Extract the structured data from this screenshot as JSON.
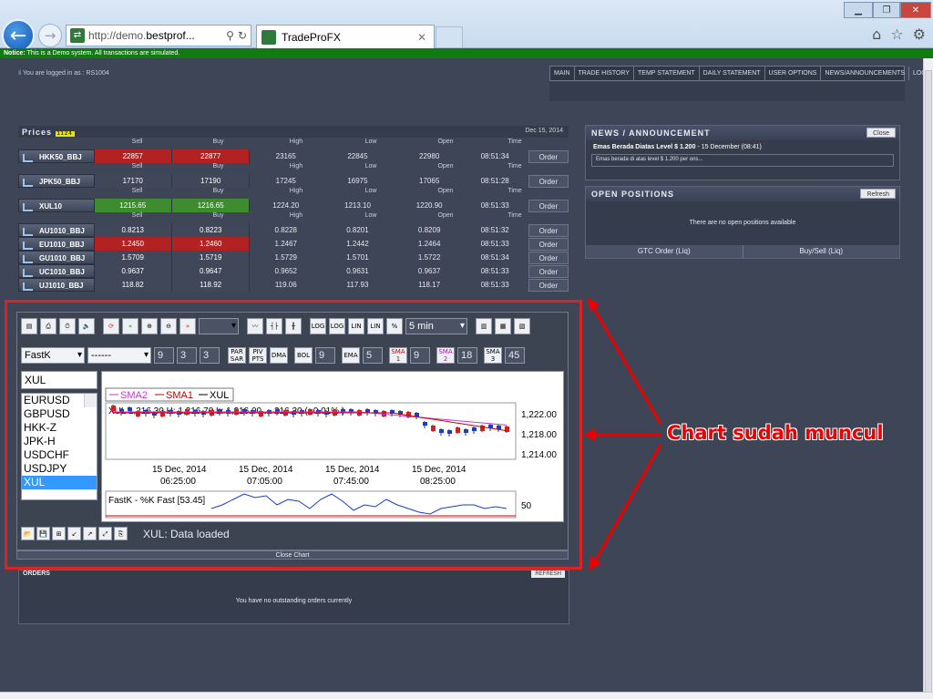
{
  "browser": {
    "url_prefix": "http://demo.",
    "url_domain": "bestprof...",
    "tab_title": "TradeProFX"
  },
  "notice": {
    "label": "Notice:",
    "text": "This is a Demo system. All transactions are simulated."
  },
  "header": {
    "logged_in": "You are logged in as : RS1004",
    "menu": [
      "Main",
      "Trade History",
      "Temp Statement",
      "Daily Statement",
      "User Options",
      "News/Announcements",
      "Logout"
    ]
  },
  "prices": {
    "title": "Prices",
    "date": "Dec 15, 2014",
    "columns": [
      "Sell",
      "Buy",
      "High",
      "Low",
      "Open",
      "Time"
    ],
    "order_label": "Order",
    "rows": [
      {
        "symbol": "HKK50_BBJ",
        "sell": "22857",
        "buy": "22877",
        "high": "23165",
        "low": "22845",
        "open": "22980",
        "time": "08:51:34",
        "color": "red",
        "header": true
      },
      {
        "symbol": "JPK50_BBJ",
        "sell": "17170",
        "buy": "17190",
        "high": "17245",
        "low": "16975",
        "open": "17065",
        "time": "08:51:28",
        "color": "neutral",
        "header": true
      },
      {
        "symbol": "XUL10",
        "sell": "1215.65",
        "buy": "1216.65",
        "high": "1224.20",
        "low": "1213.10",
        "open": "1220.90",
        "time": "08:51:33",
        "color": "green",
        "header": true
      },
      {
        "symbol": "AU1010_BBJ",
        "sell": "0.8213",
        "buy": "0.8223",
        "high": "0.8228",
        "low": "0.8201",
        "open": "0.8209",
        "time": "08:51:32",
        "color": "neutral",
        "header": true
      },
      {
        "symbol": "EU1010_BBJ",
        "sell": "1.2450",
        "buy": "1.2460",
        "high": "1.2467",
        "low": "1.2442",
        "open": "1.2464",
        "time": "08:51:33",
        "color": "red",
        "header": false
      },
      {
        "symbol": "GU1010_BBJ",
        "sell": "1.5709",
        "buy": "1.5719",
        "high": "1.5729",
        "low": "1.5701",
        "open": "1.5722",
        "time": "08:51:34",
        "color": "neutral",
        "header": false
      },
      {
        "symbol": "UC1010_BBJ",
        "sell": "0.9637",
        "buy": "0.9647",
        "high": "0.9652",
        "low": "0.9631",
        "open": "0.9637",
        "time": "08:51:33",
        "color": "neutral",
        "header": false
      },
      {
        "symbol": "UJ1010_BBJ",
        "sell": "118.82",
        "buy": "118.92",
        "high": "119.06",
        "low": "117.93",
        "open": "118.17",
        "time": "08:51:33",
        "color": "neutral",
        "header": false
      }
    ]
  },
  "news": {
    "title": "News / Announcement",
    "close_label": "Close",
    "headline": "Emas Berada Diatas Level $ 1.200",
    "headline_date": " - 15 December (08:41)",
    "body": "Emas berada di atas level $ 1.200 per ons..."
  },
  "positions": {
    "title": "Open Positions",
    "refresh_label": "Refresh",
    "empty": "There are no open positions available",
    "gtc_label": "GTC Order (Liq)",
    "buysell_label": "Buy/Sell (Liq)"
  },
  "chart": {
    "interval": "5 min",
    "indicator": "FastK",
    "line_style": "------",
    "params": [
      "9",
      "3",
      "3"
    ],
    "par_sar": "PAR SAR",
    "piv_pts": "PIV PTS",
    "dma": "DMA",
    "bol": "BOL",
    "bol_val": "9",
    "ema": "EMA",
    "ema_val": "5",
    "sma1": "SMA 1",
    "sma1_val": "9",
    "sma2": "SMA 2",
    "sma2_val": "18",
    "sma3": "SMA 3",
    "sma3_val": "45",
    "symbol_input": "XUL",
    "symbols": [
      "EURUSD",
      "GBPUSD",
      "HKK-Z",
      "JPK-H",
      "USDCHF",
      "USDJPY",
      "XUL"
    ],
    "selected_symbol": "XUL",
    "legend": [
      "SMA2",
      "SMA1",
      "XUL"
    ],
    "ohlc_text": "XUL   1,216.30  H: 1,216.70  L: 1,216.00 ... 216.30 ( -0.01% )",
    "price_ticks": [
      "1,222.00",
      "1,218.00",
      "1,214.00"
    ],
    "time_ticks": [
      {
        "date": "15 Dec, 2014",
        "time": "06:25:00"
      },
      {
        "date": "15 Dec, 2014",
        "time": "07:05:00"
      },
      {
        "date": "15 Dec, 2014",
        "time": "07:45:00"
      },
      {
        "date": "15 Dec, 2014",
        "time": "08:25:00"
      }
    ],
    "osc_label": "FastK - %K Fast [53.45]",
    "osc_tick": "50",
    "status": "XUL: Data loaded",
    "close_label": "Close Chart",
    "colors": {
      "sma2": "#cc33cc",
      "sma1": "#cc0000",
      "up": "#1a3ccf",
      "down": "#d32020"
    }
  },
  "orders": {
    "title": "Orders",
    "refresh_label": "Refresh",
    "empty": "You have no outstanding orders currently"
  },
  "annotation": "Chart sudah muncul"
}
